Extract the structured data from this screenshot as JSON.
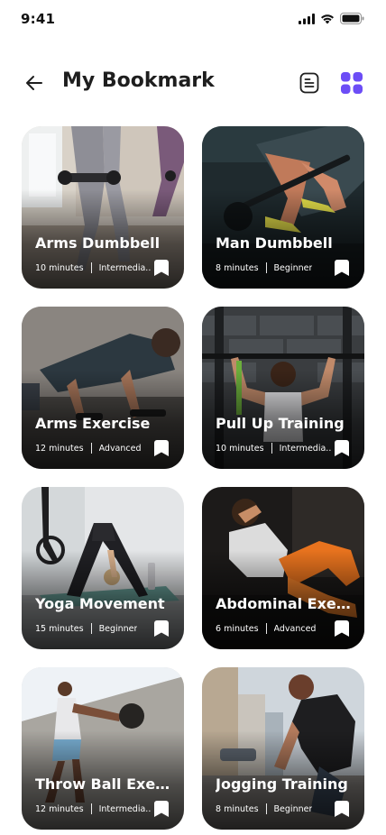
{
  "status_bar": {
    "time": "9:41"
  },
  "header": {
    "title": "My Bookmark",
    "back_icon": "arrow-left-icon",
    "list_view_icon": "list-view-icon",
    "grid_view_icon": "grid-view-icon"
  },
  "colors": {
    "accent": "#6C4DF6",
    "text": "#1E1E1E",
    "background": "#FFFFFF"
  },
  "cards": [
    {
      "title": "Arms Dumbbell",
      "duration": "10 minutes",
      "level": "Intermedia..",
      "bookmark_icon": "bookmark-icon"
    },
    {
      "title": "Man Dumbbell",
      "duration": "8 minutes",
      "level": "Beginner",
      "bookmark_icon": "bookmark-icon"
    },
    {
      "title": "Arms Exercise",
      "duration": "12 minutes",
      "level": "Advanced",
      "bookmark_icon": "bookmark-icon"
    },
    {
      "title": "Pull Up Training",
      "duration": "10 minutes",
      "level": "Intermedia..",
      "bookmark_icon": "bookmark-icon"
    },
    {
      "title": "Yoga Movement",
      "duration": "15 minutes",
      "level": "Beginner",
      "bookmark_icon": "bookmark-icon"
    },
    {
      "title": "Abdominal Exerc..",
      "duration": "6 minutes",
      "level": "Advanced",
      "bookmark_icon": "bookmark-icon"
    },
    {
      "title": "Throw Ball Exerc..",
      "duration": "12 minutes",
      "level": "Intermedia..",
      "bookmark_icon": "bookmark-icon"
    },
    {
      "title": "Jogging Training",
      "duration": "8 minutes",
      "level": "Beginner",
      "bookmark_icon": "bookmark-icon"
    }
  ]
}
